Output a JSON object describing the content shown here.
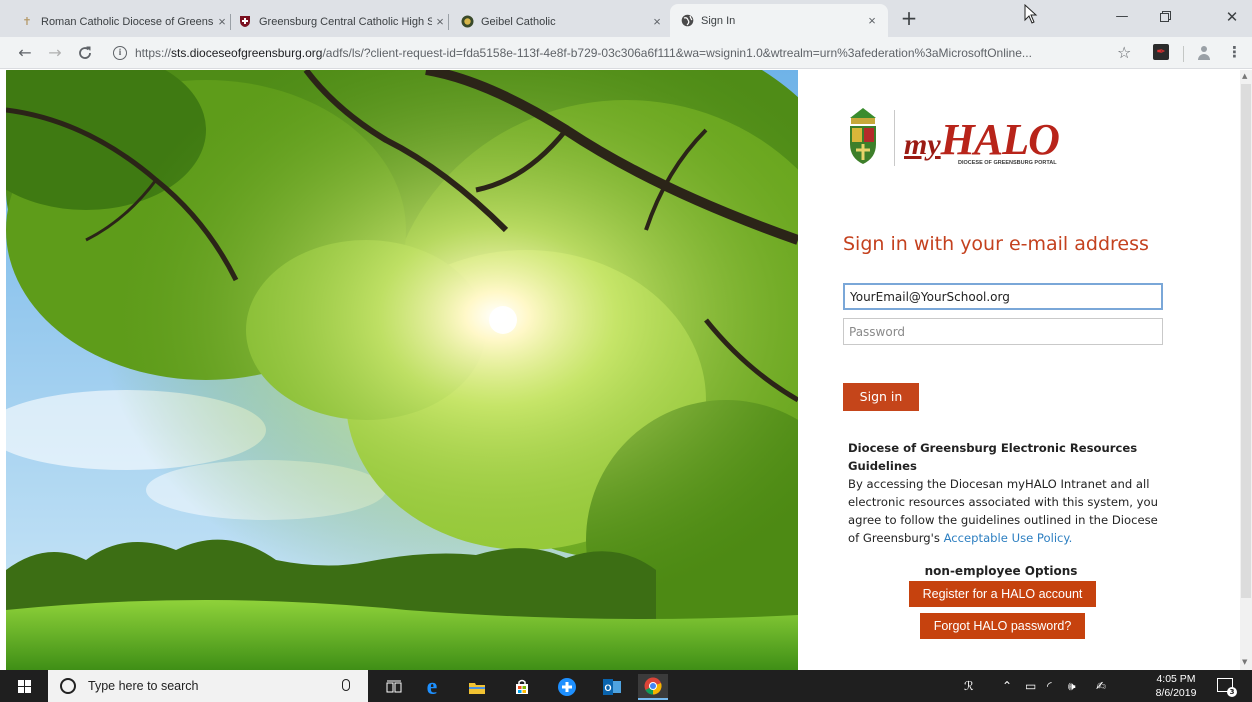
{
  "browser": {
    "tabs": [
      {
        "title": "Roman Catholic Diocese of Greensburg",
        "icon": "cross-favicon-icon",
        "active": false
      },
      {
        "title": "Greensburg Central Catholic High School",
        "icon": "crest-favicon-icon",
        "active": false
      },
      {
        "title": "Geibel Catholic",
        "icon": "seal-favicon-icon",
        "active": false
      },
      {
        "title": "Sign In",
        "icon": "globe-favicon-icon",
        "active": true
      }
    ],
    "new_tab_label": "+",
    "close_glyph": "×",
    "url_scheme": "https://",
    "url_host": "sts.dioceseofgreensburg.org",
    "url_path": "/adfs/ls/?client-request-id=fda5158e-113f-4e8f-b729-03c306a6f111&wa=wsignin1.0&wtrealm=urn%3afederation%3aMicrosoftOnline..."
  },
  "page": {
    "logo": {
      "brand_prefix": "my",
      "brand_main": "HALO",
      "tagline": "DIOCESE OF GREENSBURG PORTAL"
    },
    "heading": "Sign in with your e-mail address",
    "email_value": "YourEmail@YourSchool.org",
    "password_placeholder": "Password",
    "signin_label": "Sign in",
    "guidelines_title": "Diocese of Greensburg Electronic Resources Guidelines",
    "guidelines_body": "By accessing the Diocesan myHALO Intranet and all electronic resources associated with this system, you agree to follow the guidelines outlined in the Diocese of Greensburg's",
    "policy_link": "Acceptable Use Policy.",
    "options_label": "non-employee Options",
    "register_label": "Register for a HALO account",
    "forgot_label": "Forgot HALO password?",
    "colors": {
      "accent": "#c5451a",
      "link": "#2d7fc1",
      "focus_border": "#7aa7d8"
    }
  },
  "taskbar": {
    "search_placeholder": "Type here to search",
    "time": "4:05 PM",
    "date": "8/6/2019",
    "notification_count": "3"
  }
}
